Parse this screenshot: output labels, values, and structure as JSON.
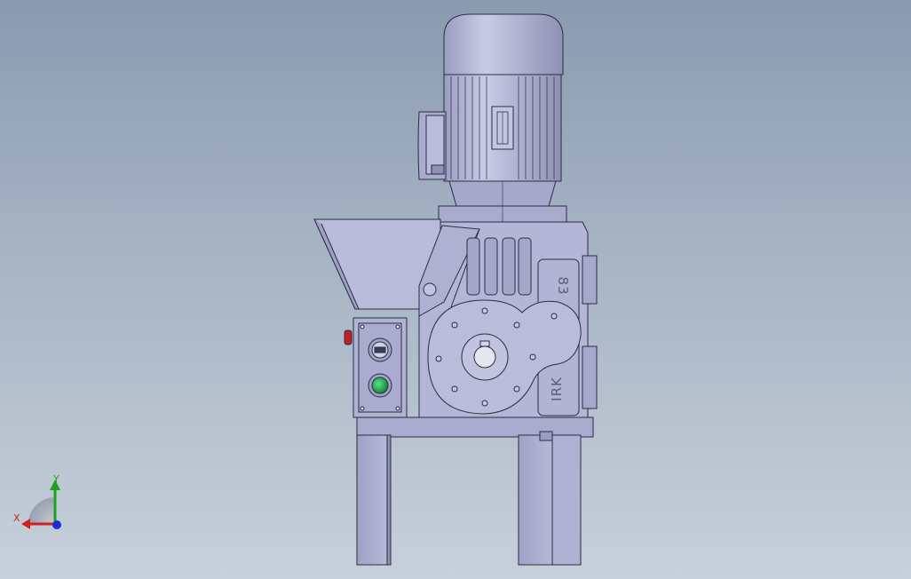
{
  "viewport": {
    "background_top": "#8a9bb0",
    "background_bottom": "#c7d0da"
  },
  "model": {
    "casting_text_1": "83",
    "casting_text_2": "IRK",
    "part_color": "#b3b6d6",
    "edge_color": "#2a2d44",
    "start_button_color": "#1fa34a",
    "indicator_color": "#c02020"
  },
  "triad": {
    "x_label": "X",
    "y_label": "Y",
    "x_color": "#d02020",
    "y_color": "#20a020",
    "z_color": "#2030d0"
  }
}
